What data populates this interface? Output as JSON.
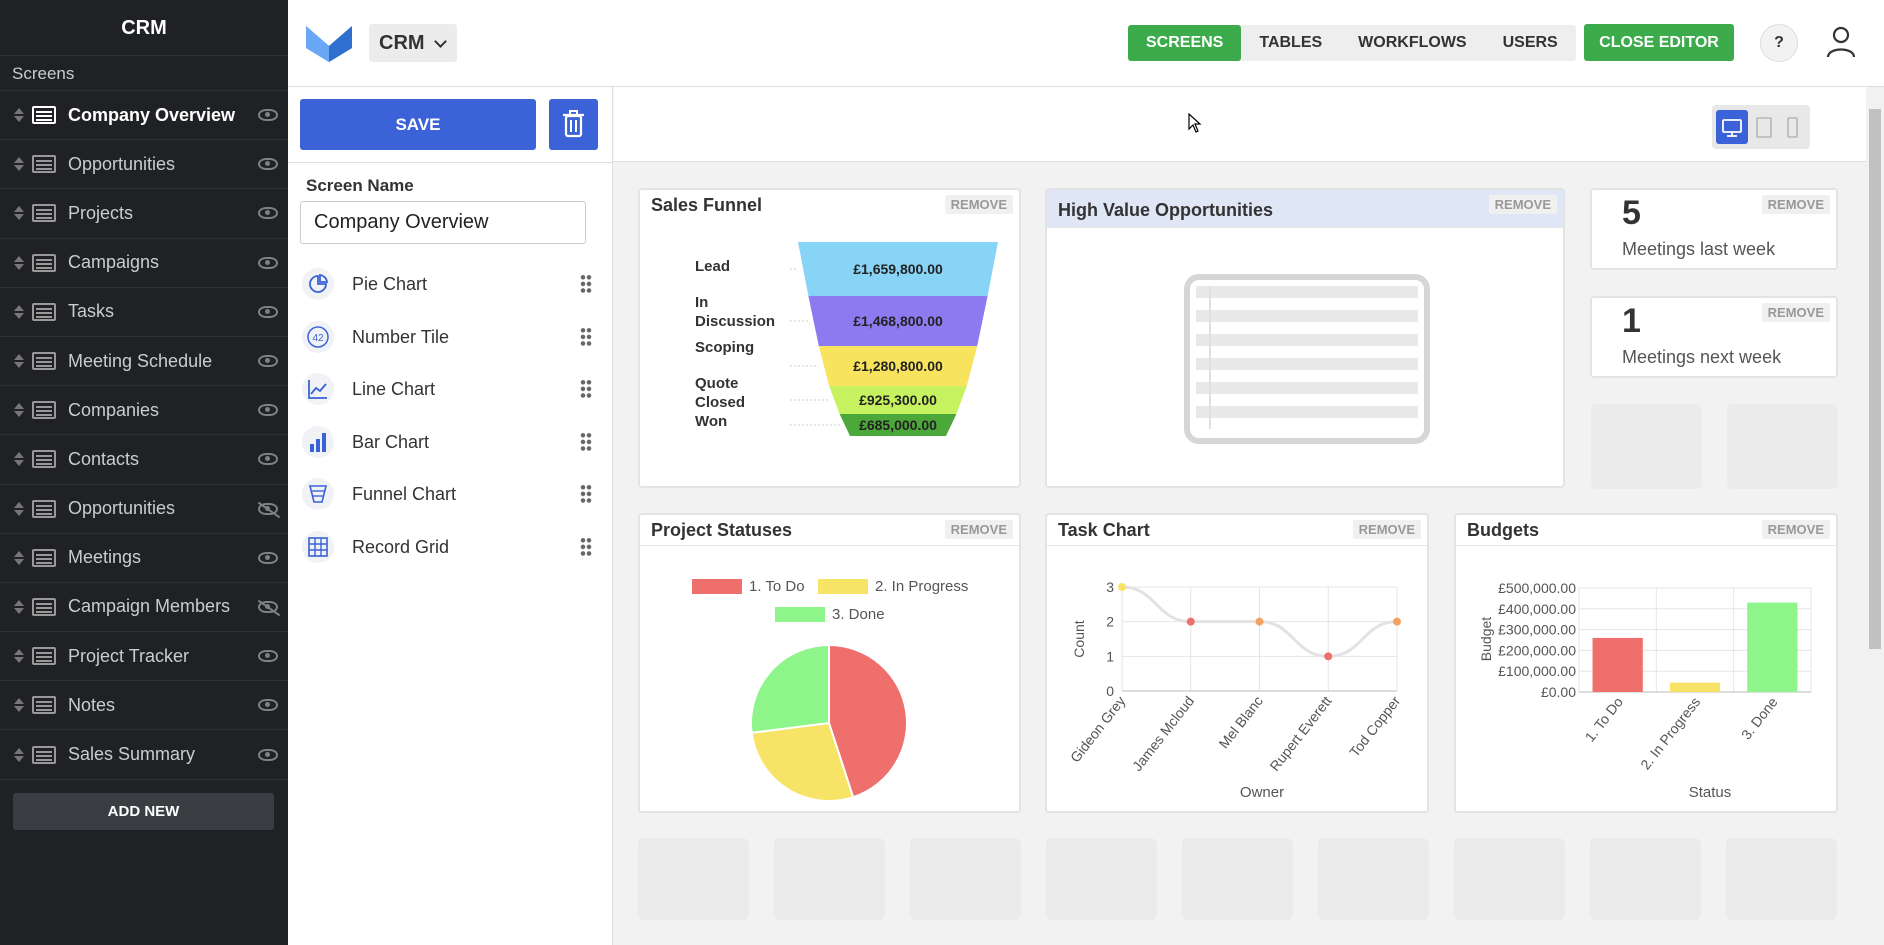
{
  "sidebar": {
    "app_title": "CRM",
    "section_label": "Screens",
    "add_new_label": "ADD NEW",
    "items": [
      {
        "label": "Company Overview",
        "active": true,
        "visible": true
      },
      {
        "label": "Opportunities",
        "visible": true
      },
      {
        "label": "Projects",
        "visible": true
      },
      {
        "label": "Campaigns",
        "visible": true
      },
      {
        "label": "Tasks",
        "visible": true
      },
      {
        "label": "Meeting Schedule",
        "visible": true
      },
      {
        "label": "Companies",
        "visible": true
      },
      {
        "label": "Contacts",
        "visible": true
      },
      {
        "label": "Opportunities",
        "visible": false
      },
      {
        "label": "Meetings",
        "visible": true
      },
      {
        "label": "Campaign Members",
        "visible": false
      },
      {
        "label": "Project Tracker",
        "visible": true
      },
      {
        "label": "Notes",
        "visible": true
      },
      {
        "label": "Sales Summary",
        "visible": true
      }
    ]
  },
  "topbar": {
    "app_name": "CRM",
    "tabs": [
      "SCREENS",
      "TABLES",
      "WORKFLOWS",
      "USERS"
    ],
    "active_tab": "SCREENS",
    "close_editor_label": "CLOSE EDITOR",
    "help_label": "?"
  },
  "editor": {
    "save_label": "SAVE",
    "screen_name_label": "Screen Name",
    "screen_name_value": "Company Overview",
    "components": [
      {
        "label": "Pie Chart",
        "icon": "pie-chart-icon"
      },
      {
        "label": "Number Tile",
        "icon": "number-tile-icon",
        "icon_text": "42"
      },
      {
        "label": "Line Chart",
        "icon": "line-chart-icon"
      },
      {
        "label": "Bar Chart",
        "icon": "bar-chart-icon"
      },
      {
        "label": "Funnel Chart",
        "icon": "funnel-chart-icon"
      },
      {
        "label": "Record Grid",
        "icon": "record-grid-icon"
      }
    ]
  },
  "widgets": {
    "remove_label": "REMOVE",
    "sales_funnel": {
      "title": "Sales Funnel"
    },
    "high_value": {
      "title": "High Value Opportunities"
    },
    "tile1": {
      "value": "5",
      "label": "Meetings last week"
    },
    "tile2": {
      "value": "1",
      "label": "Meetings next week"
    },
    "project_statuses": {
      "title": "Project Statuses"
    },
    "task_chart": {
      "title": "Task Chart"
    },
    "budgets": {
      "title": "Budgets"
    }
  },
  "colors": {
    "accent_blue": "#3b62d6",
    "accent_green": "#3cab4b",
    "sidebar_bg": "#1f2124"
  },
  "chart_data": [
    {
      "type": "funnel",
      "title": "Sales Funnel",
      "categories": [
        "Lead",
        "In Discussion",
        "Scoping",
        "Quote",
        "Closed Won"
      ],
      "value_labels": [
        "£1,659,800.00",
        "£1,468,800.00",
        "£1,280,800.00",
        "£925,300.00",
        "£685,000.00"
      ],
      "values": [
        1659800,
        1468800,
        1280800,
        925300,
        685000
      ],
      "colors": [
        "#87d4f7",
        "#8d79f0",
        "#f7e35e",
        "#c5f25e",
        "#4da83a"
      ]
    },
    {
      "type": "pie",
      "title": "Project Statuses",
      "categories": [
        "1. To Do",
        "2. In Progress",
        "3. Done"
      ],
      "values": [
        45,
        28,
        27
      ],
      "colors": [
        "#ef6f6c",
        "#f7e466",
        "#8ef58b"
      ],
      "legend": "top"
    },
    {
      "type": "line",
      "title": "Task Chart",
      "categories": [
        "Gideon Grey",
        "James Mcloud",
        "Mel Blanc",
        "Rupert Everett",
        "Tod Copper"
      ],
      "values": [
        3,
        2,
        2,
        1,
        2
      ],
      "point_colors": [
        "#f7e466",
        "#ef6f6c",
        "#f4a261",
        "#ef6f6c",
        "#f4a261"
      ],
      "xlabel": "Owner",
      "ylabel": "Count",
      "ylim": [
        0,
        3
      ],
      "yticks": [
        "0",
        "1",
        "2",
        "3"
      ],
      "grid": true
    },
    {
      "type": "bar",
      "title": "Budgets",
      "categories": [
        "1. To Do",
        "2. In Progress",
        "3. Done"
      ],
      "values": [
        260000,
        45000,
        430000
      ],
      "colors": [
        "#ef6f6c",
        "#f7e466",
        "#8ef58b"
      ],
      "xlabel": "Status",
      "ylabel": "Budget",
      "ylim": [
        0,
        500000
      ],
      "yticks": [
        "£0.00",
        "£100,000.00",
        "£200,000.00",
        "£300,000.00",
        "£400,000.00",
        "£500,000.00"
      ],
      "grid": true
    }
  ]
}
